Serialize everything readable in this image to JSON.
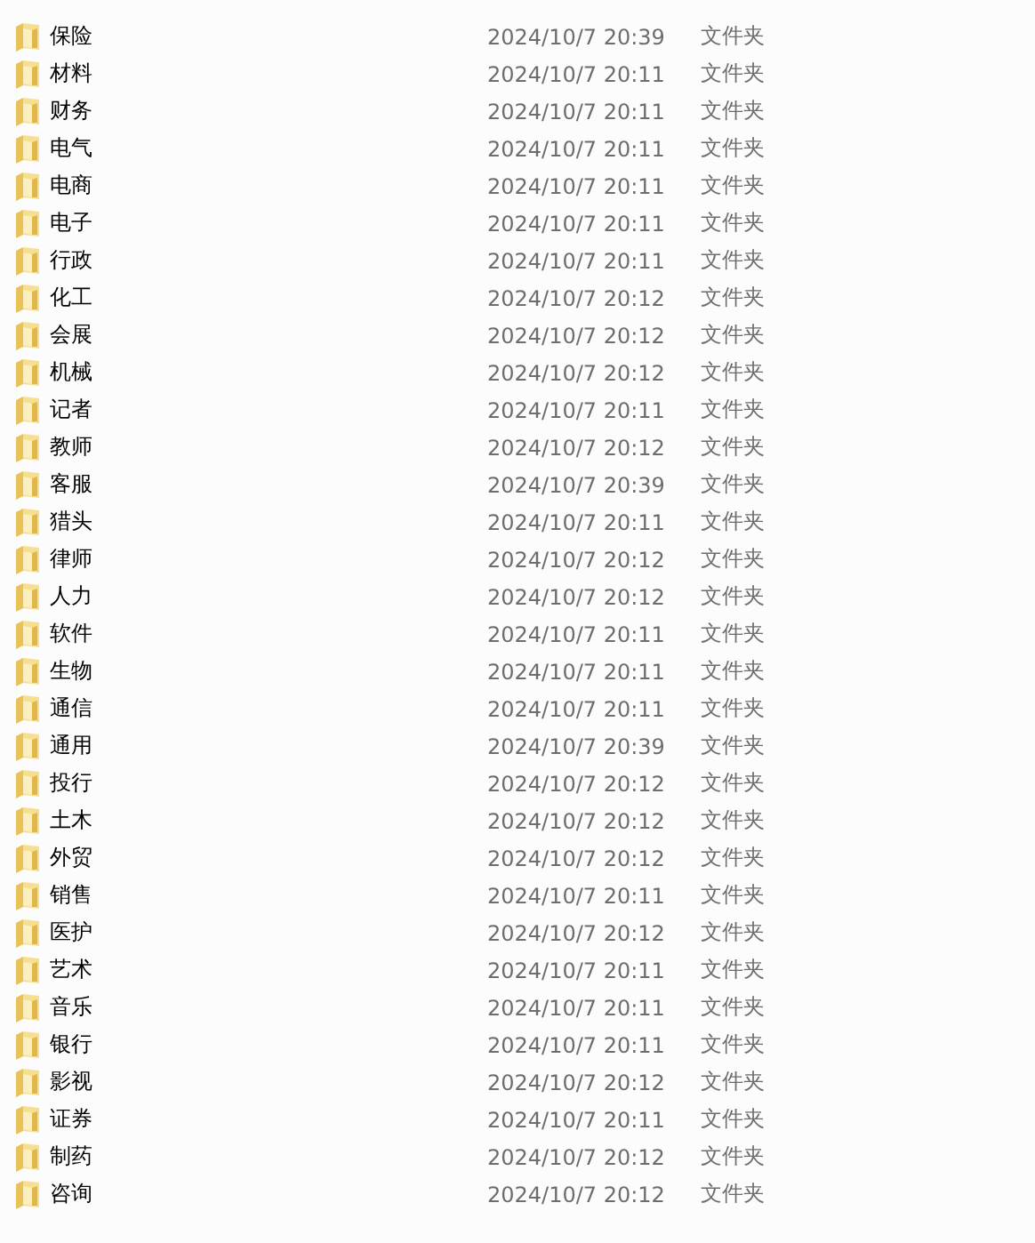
{
  "files": [
    {
      "name": "保险",
      "modified": "2024/10/7 20:39",
      "type": "文件夹"
    },
    {
      "name": "材料",
      "modified": "2024/10/7 20:11",
      "type": "文件夹"
    },
    {
      "name": "财务",
      "modified": "2024/10/7 20:11",
      "type": "文件夹"
    },
    {
      "name": "电气",
      "modified": "2024/10/7 20:11",
      "type": "文件夹"
    },
    {
      "name": "电商",
      "modified": "2024/10/7 20:11",
      "type": "文件夹"
    },
    {
      "name": "电子",
      "modified": "2024/10/7 20:11",
      "type": "文件夹"
    },
    {
      "name": "行政",
      "modified": "2024/10/7 20:11",
      "type": "文件夹"
    },
    {
      "name": "化工",
      "modified": "2024/10/7 20:12",
      "type": "文件夹"
    },
    {
      "name": "会展",
      "modified": "2024/10/7 20:12",
      "type": "文件夹"
    },
    {
      "name": "机械",
      "modified": "2024/10/7 20:12",
      "type": "文件夹"
    },
    {
      "name": "记者",
      "modified": "2024/10/7 20:11",
      "type": "文件夹"
    },
    {
      "name": "教师",
      "modified": "2024/10/7 20:12",
      "type": "文件夹"
    },
    {
      "name": "客服",
      "modified": "2024/10/7 20:39",
      "type": "文件夹"
    },
    {
      "name": "猎头",
      "modified": "2024/10/7 20:11",
      "type": "文件夹"
    },
    {
      "name": "律师",
      "modified": "2024/10/7 20:12",
      "type": "文件夹"
    },
    {
      "name": "人力",
      "modified": "2024/10/7 20:12",
      "type": "文件夹"
    },
    {
      "name": "软件",
      "modified": "2024/10/7 20:11",
      "type": "文件夹"
    },
    {
      "name": "生物",
      "modified": "2024/10/7 20:11",
      "type": "文件夹"
    },
    {
      "name": "通信",
      "modified": "2024/10/7 20:11",
      "type": "文件夹"
    },
    {
      "name": "通用",
      "modified": "2024/10/7 20:39",
      "type": "文件夹"
    },
    {
      "name": "投行",
      "modified": "2024/10/7 20:12",
      "type": "文件夹"
    },
    {
      "name": "土木",
      "modified": "2024/10/7 20:12",
      "type": "文件夹"
    },
    {
      "name": "外贸",
      "modified": "2024/10/7 20:12",
      "type": "文件夹"
    },
    {
      "name": "销售",
      "modified": "2024/10/7 20:11",
      "type": "文件夹"
    },
    {
      "name": "医护",
      "modified": "2024/10/7 20:12",
      "type": "文件夹"
    },
    {
      "name": "艺术",
      "modified": "2024/10/7 20:11",
      "type": "文件夹"
    },
    {
      "name": "音乐",
      "modified": "2024/10/7 20:11",
      "type": "文件夹"
    },
    {
      "name": "银行",
      "modified": "2024/10/7 20:11",
      "type": "文件夹"
    },
    {
      "name": "影视",
      "modified": "2024/10/7 20:12",
      "type": "文件夹"
    },
    {
      "name": "证券",
      "modified": "2024/10/7 20:11",
      "type": "文件夹"
    },
    {
      "name": "制药",
      "modified": "2024/10/7 20:12",
      "type": "文件夹"
    },
    {
      "name": "咨询",
      "modified": "2024/10/7 20:12",
      "type": "文件夹"
    }
  ]
}
